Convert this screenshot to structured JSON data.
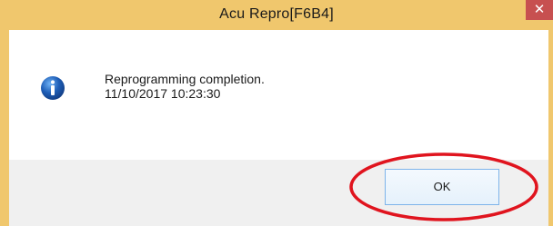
{
  "window": {
    "title": "Acu Repro[F6B4]",
    "close_glyph": "✕"
  },
  "message": {
    "icon": "info-icon",
    "line1": "Reprogramming  completion.",
    "line2": "11/10/2017 10:23:30"
  },
  "buttons": {
    "ok_label": "OK"
  },
  "annotation": {
    "color": "#e0141e",
    "shape": "ellipse around OK button"
  },
  "colors": {
    "titlebar": "#f0c76d",
    "close_button": "#c75050",
    "icon_blue": "#1f5fb8",
    "button_border": "#7eb4ea"
  }
}
